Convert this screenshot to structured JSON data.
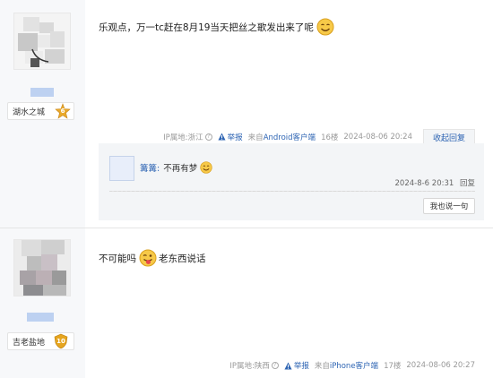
{
  "post1": {
    "content": "乐观点，万一tc赶在8月19当天把丝之歌发出来了呢",
    "badge_name": "湖水之城",
    "level": "6",
    "ip": "IP属地:浙江",
    "report": "举报",
    "source": "来自",
    "client": "Android客户端",
    "floor": "16楼",
    "time": "2024-08-06 20:24",
    "reply_tab": "收起回复",
    "reply": {
      "name": "篝篝:",
      "text": "不再有梦",
      "time": "2024-8-6 20:31",
      "reply_link": "回复",
      "say_button": "我也说一句"
    }
  },
  "post2": {
    "content_a": "不可能吗",
    "content_b": "老东西说话",
    "badge_name": "吉老盐地",
    "level": "10",
    "ip": "IP属地:陕西",
    "report": "举报",
    "source": "来自",
    "client": "iPhone客户端",
    "floor": "17楼",
    "time": "2024-08-06 20:27"
  },
  "colors": {
    "link": "#2d64b3",
    "sidebar": "#f7f8fa",
    "badge_gold": "#e9a92a"
  }
}
